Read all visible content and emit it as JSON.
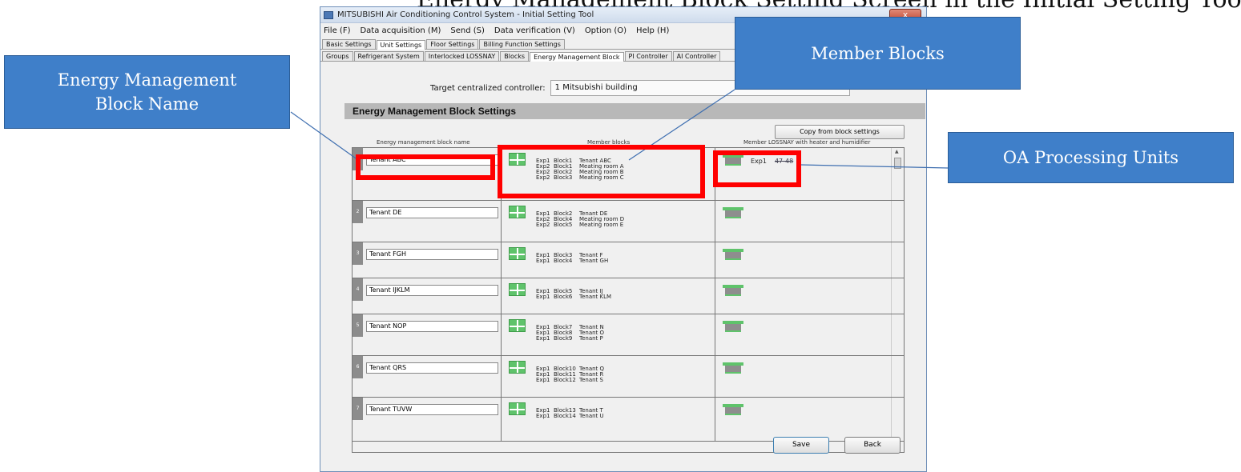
{
  "top_caption": "Energy Management Block Setting Screen in the Initial Setting Tool",
  "window": {
    "title": "MITSUBISHI Air Conditioning Control System - Initial Setting Tool",
    "close_label": "x"
  },
  "menu": [
    "File (F)",
    "Data acquisition (M)",
    "Send (S)",
    "Data verification (V)",
    "Option (O)",
    "Help (H)"
  ],
  "tabs_main": [
    "Basic Settings",
    "Unit Settings",
    "Floor Settings",
    "Billing Function Settings"
  ],
  "tabs_sub": [
    "Groups",
    "Refrigerant System",
    "Interlocked LOSSNAY",
    "Blocks",
    "Energy Management Block",
    "PI Controller",
    "AI Controller"
  ],
  "target_label": "Target centralized controller:",
  "target_value": "1  Mitsubishi building",
  "section_title": "Energy Management Block Settings",
  "copy_button": "Copy from block settings",
  "column_headers": {
    "name": "Energy management block name",
    "members": "Member blocks",
    "oa": "Member LOSSNAY with heater and humidifier"
  },
  "rows": [
    {
      "num": "1",
      "name": "Tenant ABC",
      "members": [
        [
          "Exp1",
          "Block1",
          "Tenant ABC"
        ],
        [
          "Exp2",
          "Block1",
          "Meating room A"
        ],
        [
          "Exp2",
          "Block2",
          "Meating room B"
        ],
        [
          "Exp2",
          "Block3",
          "Meating room C"
        ]
      ],
      "oa": "Exp1",
      "oa_addr": "47-48"
    },
    {
      "num": "2",
      "name": "Tenant DE",
      "members": [
        [
          "Exp1",
          "Block2",
          "Tenant DE"
        ],
        [
          "Exp2",
          "Block4",
          "Meating room D"
        ],
        [
          "Exp2",
          "Block5",
          "Meating room E"
        ]
      ]
    },
    {
      "num": "3",
      "name": "Tenant FGH",
      "members": [
        [
          "Exp1",
          "Block3",
          "Tenant F"
        ],
        [
          "Exp1",
          "Block4",
          "Tenant GH"
        ]
      ]
    },
    {
      "num": "4",
      "name": "Tenant IJKLM",
      "members": [
        [
          "Exp1",
          "Block5",
          "Tenant IJ"
        ],
        [
          "Exp1",
          "Block6",
          "Tenant KLM"
        ]
      ]
    },
    {
      "num": "5",
      "name": "Tenant NOP",
      "members": [
        [
          "Exp1",
          "Block7",
          "Tenant N"
        ],
        [
          "Exp1",
          "Block8",
          "Tenant O"
        ],
        [
          "Exp1",
          "Block9",
          "Tenant P"
        ]
      ]
    },
    {
      "num": "6",
      "name": "Tenant QRS",
      "members": [
        [
          "Exp1",
          "Block10",
          "Tenant Q"
        ],
        [
          "Exp1",
          "Block11",
          "Tenant R"
        ],
        [
          "Exp1",
          "Block12",
          "Tenant S"
        ]
      ]
    },
    {
      "num": "7",
      "name": "Tenant TUVW",
      "members": [
        [
          "Exp1",
          "Block13",
          "Tenant T"
        ],
        [
          "Exp1",
          "Block14",
          "Tenant U"
        ]
      ]
    }
  ],
  "buttons": {
    "save": "Save",
    "back": "Back"
  },
  "callouts": {
    "name": "Energy Management\nBlock Name",
    "members": "Member Blocks",
    "oa": "OA Processing Units"
  },
  "colors": {
    "callout": "#3f7fc9",
    "highlight": "#ff0000",
    "block_icon": "#5fc36b"
  }
}
